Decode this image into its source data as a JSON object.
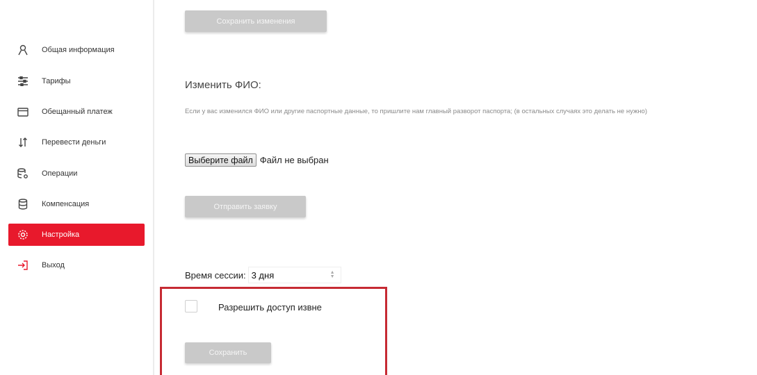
{
  "sidebar": {
    "items": [
      {
        "label": "Общая информация",
        "icon": "user-icon"
      },
      {
        "label": "Тарифы",
        "icon": "sliders-icon"
      },
      {
        "label": "Обещанный платеж",
        "icon": "card-icon"
      },
      {
        "label": "Перевести деньги",
        "icon": "transfer-icon"
      },
      {
        "label": "Операции",
        "icon": "database-gear-icon"
      },
      {
        "label": "Компенсация",
        "icon": "database-icon"
      },
      {
        "label": "Настройка",
        "icon": "gear-icon",
        "active": true
      },
      {
        "label": "Выход",
        "icon": "logout-icon"
      }
    ]
  },
  "main": {
    "save_changes_label": "Сохранить изменения",
    "change_name_heading": "Изменить ФИО:",
    "change_name_hint": "Если у вас изменился ФИО или другие паспортные данные, то пришлите нам главный разворот паспорта; (в остальных случаях это делать не нужно)",
    "file_button_label": "Выберите файл",
    "file_status": "Файл не выбран",
    "submit_request_label": "Отправить заявку",
    "session_label": "Время сессии:",
    "session_value": "3 дня",
    "allow_access_label": "Разрешить доступ извне",
    "allow_access_checked": false,
    "save_label": "Сохранить"
  },
  "colors": {
    "accent": "#e8192c",
    "highlight_border": "#c62a33",
    "button_gray": "#c9c9c9"
  }
}
